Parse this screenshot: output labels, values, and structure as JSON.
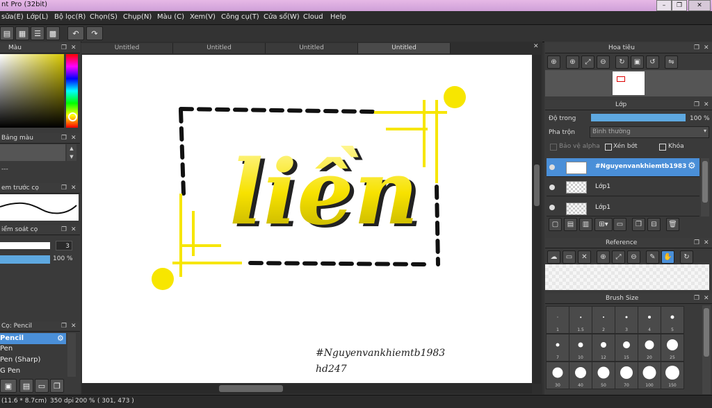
{
  "window": {
    "title": "nt Pro (32bit)"
  },
  "menu": [
    "sửa(E)",
    "Lớp(L)",
    "Bộ lọc(R)",
    "Chọn(S)",
    "Chụp(N)",
    "Màu (C)",
    "Xem(V)",
    "Công cụ(T)",
    "Cửa sổ(W)",
    "Cloud",
    "Help"
  ],
  "tabs": [
    "Untitled",
    "Untitled",
    "Untitled",
    "Untitled"
  ],
  "left": {
    "color_panel": "Màu",
    "palette_panel": "Bảng màu",
    "palette_value": "---",
    "brush_preview_panel": "em trước cọ",
    "control_panel": "iểm soát cọ",
    "size_value": "3",
    "opacity_value": "100 %",
    "tool_panel": "Cọ: Pencil",
    "tools": [
      "Pencil",
      "Pen",
      "Pen (Sharp)",
      "G Pen"
    ]
  },
  "right": {
    "navigator_title": "Hoa tiêu",
    "layer_title": "Lớp",
    "opacity_label": "Độ trong",
    "opacity_value": "100 %",
    "blend_label": "Pha trộn",
    "blend_value": "Bình thường",
    "check_alpha": "Bảo vệ alpha",
    "check_clip": "Xén bớt",
    "check_lock": "Khóa",
    "layers": [
      "#Nguyenvankhiemtb1983",
      "Lớp1",
      "Lớp1"
    ],
    "reference_title": "Reference",
    "brushsize_title": "Brush Size",
    "brush_sizes": [
      "1",
      "1.5",
      "2",
      "3",
      "4",
      "5",
      "7",
      "10",
      "12",
      "15",
      "20",
      "25",
      "30",
      "40",
      "50",
      "70",
      "100",
      "150"
    ]
  },
  "canvas": {
    "main_word": "liền",
    "signature_line1": "#Nguyenvankhiemtb1983",
    "signature_line2": "hd247"
  },
  "status": {
    "size": "(11.6 * 8.7cm)",
    "dpi": "350 dpi",
    "zoom": "200 %",
    "coords": "( 301, 473 )"
  },
  "colors": {
    "accent": "#4a8fd8",
    "yellow": "#f7e600"
  }
}
